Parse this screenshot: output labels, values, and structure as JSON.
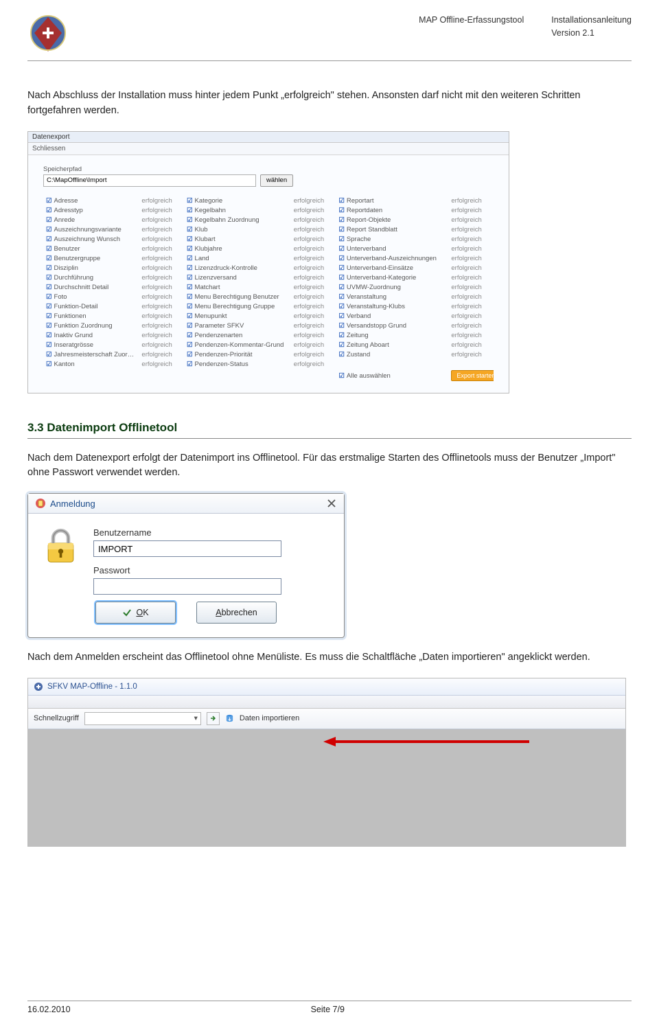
{
  "header": {
    "title": "MAP Offline-Erfassungstool",
    "doc": "Installationsanleitung",
    "version": "Version 2.1"
  },
  "p1": "Nach Abschluss der Installation muss hinter jedem Punkt „erfolgreich\" stehen. Ansonsten darf nicht mit den weiteren Schritten fortgefahren werden.",
  "export": {
    "window_title": "Datenexport",
    "close_btn": "Schliessen",
    "path_label": "Speicherpfad",
    "path_value": "C:\\MapOffline\\Import",
    "path_btn": "wählen",
    "status": "erfolgreich",
    "select_all": "Alle auswählen",
    "start_export": "Export starten",
    "col1": [
      "Adresse",
      "Adresstyp",
      "Anrede",
      "Auszeichnungsvariante",
      "Auszeichnung Wunsch",
      "Benutzer",
      "Benutzergruppe",
      "Disziplin",
      "Durchführung",
      "Durchschnitt Detail",
      "Foto",
      "Funktion-Detail",
      "Funktionen",
      "Funktion Zuordnung",
      "Inaktiv Grund",
      "Inseratgrösse",
      "Jahresmeisterschaft Zuordnung",
      "Kanton"
    ],
    "col2": [
      "Kategorie",
      "Kegelbahn",
      "Kegelbahn Zuordnung",
      "Klub",
      "Klubart",
      "Klubjahre",
      "Land",
      "Lizenzdruck-Kontrolle",
      "Lizenzversand",
      "Matchart",
      "Menu Berechtigung Benutzer",
      "Menu Berechtigung Gruppe",
      "Menupunkt",
      "Parameter SFKV",
      "Pendenzenarten",
      "Pendenzen-Kommentar-Grund",
      "Pendenzen-Priorität",
      "Pendenzen-Status"
    ],
    "col3": [
      "Reportart",
      "Reportdaten",
      "Report-Objekte",
      "Report Standblatt",
      "Sprache",
      "Unterverband",
      "Unterverband-Auszeichnungen",
      "Unterverband-Einsätze",
      "Unterverband-Kategorie",
      "UVMW-Zuordnung",
      "Veranstaltung",
      "Veranstaltung-Klubs",
      "Verband",
      "Versandstopp Grund",
      "Zeitung",
      "Zeitung Aboart",
      "Zustand"
    ]
  },
  "section_title": "3.3 Datenimport Offlinetool",
  "p2": "Nach dem Datenexport erfolgt der Datenimport ins Offlinetool. Für das erstmalige Starten des Offlinetools muss der Benutzer „Import\" ohne Passwort verwendet werden.",
  "login": {
    "title": "Anmeldung",
    "user_label": "Benutzername",
    "user_value": "IMPORT",
    "pass_label": "Passwort",
    "pass_value": "",
    "ok": "OK",
    "cancel": "Abbrechen"
  },
  "p3": "Nach dem Anmelden erscheint das Offlinetool ohne Menüliste. Es muss die Schaltfläche „Daten importieren\" angeklickt werden.",
  "app": {
    "title": "SFKV MAP-Offline - 1.1.0",
    "quick": "Schnellzugriff",
    "import_btn": "Daten importieren"
  },
  "footer": {
    "date": "16.02.2010",
    "page": "Seite 7/9"
  }
}
